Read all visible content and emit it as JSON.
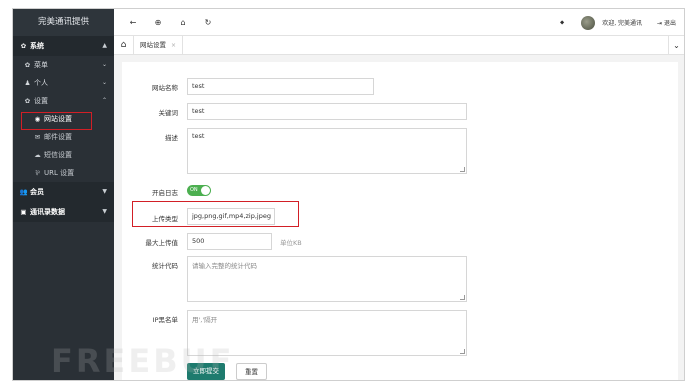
{
  "app": {
    "brand": "完美通讯提供"
  },
  "sidebar": {
    "sections": [
      {
        "label": "系统",
        "icon": "gear-icon",
        "glyph": "✿"
      },
      {
        "label": "会员",
        "icon": "users-icon",
        "glyph": "👥"
      },
      {
        "label": "通讯录数据",
        "icon": "id-card-icon",
        "glyph": "▣"
      }
    ],
    "items": [
      {
        "label": "菜单",
        "icon": "sitemap-icon",
        "glyph": "✿"
      },
      {
        "label": "个人",
        "icon": "user-icon",
        "glyph": "♟"
      },
      {
        "label": "设置",
        "icon": "cog-icon",
        "glyph": "✿"
      }
    ],
    "subitems": [
      {
        "label": "网站设置",
        "icon": "globe-icon",
        "glyph": "◉"
      },
      {
        "label": "邮件设置",
        "icon": "envelope-icon",
        "glyph": "✉"
      },
      {
        "label": "短信设置",
        "icon": "comment-icon",
        "glyph": "☁"
      },
      {
        "label": "URL 设置",
        "icon": "url-icon",
        "glyph": "⅌"
      }
    ]
  },
  "topbar": {
    "buttons": [
      {
        "name": "back-icon",
        "glyph": "←"
      },
      {
        "name": "target-icon",
        "glyph": "⊕"
      },
      {
        "name": "bank-icon",
        "glyph": "⌂"
      },
      {
        "name": "refresh-icon",
        "glyph": "↻"
      }
    ],
    "tag_glyph": "⬥",
    "welcome": "欢迎, 完美通讯",
    "logout": "退出",
    "logout_glyph": "⇥"
  },
  "tabs": {
    "home_glyph": "⌂",
    "items": [
      {
        "label": "网站设置",
        "close": "×"
      }
    ],
    "more_glyph": "⌄"
  },
  "form": {
    "site_name": {
      "label": "网站名称",
      "value": "test"
    },
    "keywords": {
      "label": "关键词",
      "value": "test"
    },
    "description": {
      "label": "描述",
      "value": "test"
    },
    "log": {
      "label": "开启日志",
      "toggle_text": "ON",
      "enabled": true
    },
    "upload_types": {
      "label": "上传类型",
      "value": "jpg,png,gif,mp4,zip,jpeg"
    },
    "max_upload": {
      "label": "最大上传值",
      "value": "500",
      "unit": "单位KB"
    },
    "stats_code": {
      "label": "统计代码",
      "placeholder": "请输入完整的统计代码"
    },
    "ip_blacklist": {
      "label": "IP黑名单",
      "placeholder": "用','隔开"
    },
    "submit": "立即提交",
    "reset": "重置"
  },
  "watermark": "FREEBUF",
  "colors": {
    "sidebar_bg": "#2a3036",
    "primary": "#1e7b6e",
    "toggle": "#4caf50",
    "highlight": "#d21f26"
  }
}
